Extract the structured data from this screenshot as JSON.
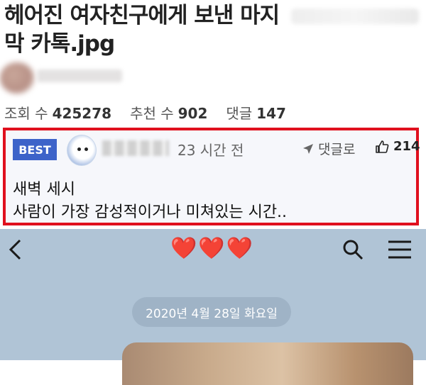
{
  "post": {
    "title": "헤어진 여자친구에게 보낸 마지막 카톡.jpg",
    "stats": {
      "views_label": "조회 수",
      "views": "425278",
      "recommend_label": "추천 수",
      "recommend": "902",
      "comments_label": "댓글",
      "comments": "147"
    }
  },
  "best_comment": {
    "badge": "BEST",
    "time": "23 시간 전",
    "reply_label": "댓글로",
    "likes": "214",
    "lines": [
      "새벽 세시",
      "사람이 가장 감성적이거나 미쳐있는 시간.."
    ]
  },
  "chat": {
    "title": "❤️❤️❤️",
    "date_divider": "2020년 4월 28일 화요일"
  },
  "colors": {
    "best_border": "#e0101e",
    "best_badge": "#3d63c9",
    "chat_background": "#b0c4d6"
  }
}
